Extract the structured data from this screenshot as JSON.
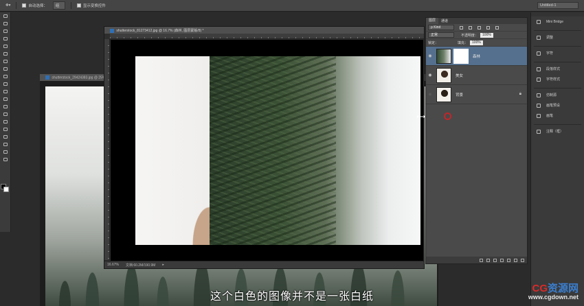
{
  "options_bar": {
    "auto_select_label": "自动选择：",
    "auto_select_value": "组",
    "show_transform_label": "显示变换控件",
    "workspace_value": "Untitled-1"
  },
  "tools": [
    "move",
    "marquee",
    "lasso",
    "quick-select",
    "crop",
    "eyedropper",
    "healing",
    "brush",
    "stamp",
    "history-brush",
    "eraser",
    "gradient",
    "blur",
    "dodge",
    "pen",
    "type",
    "path-select",
    "shape",
    "hand",
    "zoom"
  ],
  "back_document": {
    "tab_title": "shutterstock_29424383.jpg @ 25%"
  },
  "front_document": {
    "tab_title": "shutterstock_81273412.jpg @ 16.7% (森林, 图层蒙版/8) *",
    "status_zoom": "16.67%",
    "status_doc": "文档:60.2M/190.9M"
  },
  "layers_panel": {
    "tabs": [
      "图层",
      "通道"
    ],
    "filter_kind": "Kind",
    "blend_mode": "正常",
    "opacity_label": "不透明度：",
    "opacity_value": "100%",
    "lock_label": "锁定：",
    "fill_label": "填充：",
    "fill_value": "100%",
    "layers": [
      {
        "name": "森林",
        "active": true,
        "has_mask": true
      },
      {
        "name": "美女",
        "active": false,
        "has_mask": false
      },
      {
        "name": "背景",
        "active": false,
        "has_mask": false
      }
    ]
  },
  "dock": {
    "items": [
      "Mini Bridge",
      "调整",
      "字符",
      "段落样式",
      "字符样式",
      "仿制源",
      "画笔预设",
      "画笔",
      "注释（框）"
    ]
  },
  "subtitle": "这个白色的图像并不是一张白纸",
  "watermark": {
    "logo_main": "CG",
    "logo_accent": "资源网",
    "url": "www.cgdown.net"
  }
}
